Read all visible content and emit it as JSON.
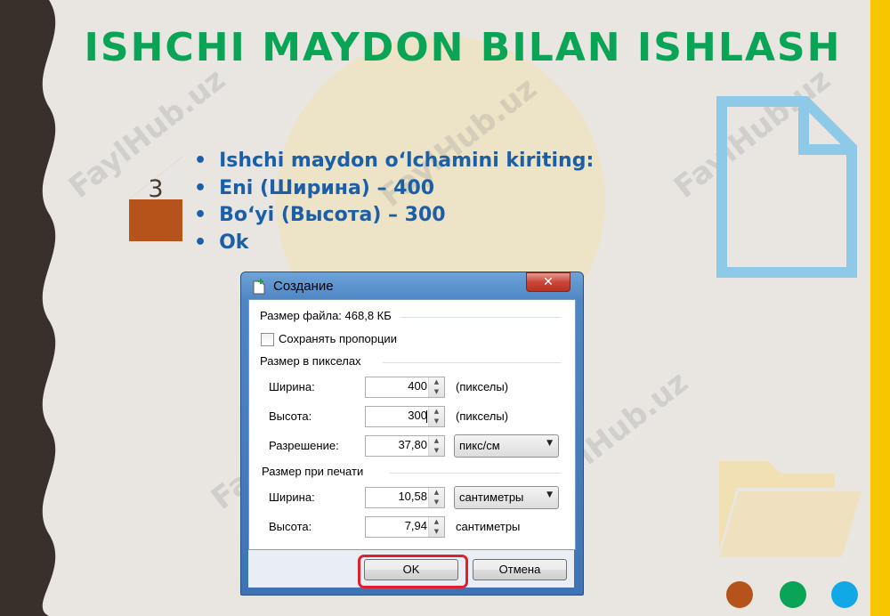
{
  "slide": {
    "title": "ISHCHI MAYDON BILAN ISHLASH",
    "step_number": "3",
    "bullets": [
      "Ishchi maydon o‘lchamini kiriting:",
      "Eni (Ширина) – 400",
      "Bo‘yi (Высота) – 300",
      "Ok"
    ],
    "watermark": "FaylHub.uz",
    "colors": {
      "title": "#0aa457",
      "bullets": "#1a5fa8",
      "stripe": "#f7c600",
      "dot1": "#b5531b",
      "dot2": "#0aa457",
      "dot3": "#12a8e6"
    },
    "icons": [
      "document-icon",
      "folder-icon"
    ]
  },
  "dialog": {
    "title": "Создание",
    "close_label": "✕",
    "file_size": "Размер файла: 468,8 КБ",
    "keep_proportions": {
      "label": "Сохранять пропорции",
      "checked": false
    },
    "pixel_group": {
      "title": "Размер в пикселах",
      "width_label": "Ширина:",
      "width_value": "400",
      "width_unit": "(пикселы)",
      "height_label": "Высота:",
      "height_value": "300",
      "height_unit": "(пикселы)",
      "resolution_label": "Разрешение:",
      "resolution_value": "37,80",
      "resolution_unit": "пикс/см"
    },
    "print_group": {
      "title": "Размер при печати",
      "width_label": "Ширина:",
      "width_value": "10,58",
      "width_unit": "сантиметры",
      "height_label": "Высота:",
      "height_value": "7,94",
      "height_unit": "сантиметры"
    },
    "ok_label": "OK",
    "cancel_label": "Отмена"
  }
}
